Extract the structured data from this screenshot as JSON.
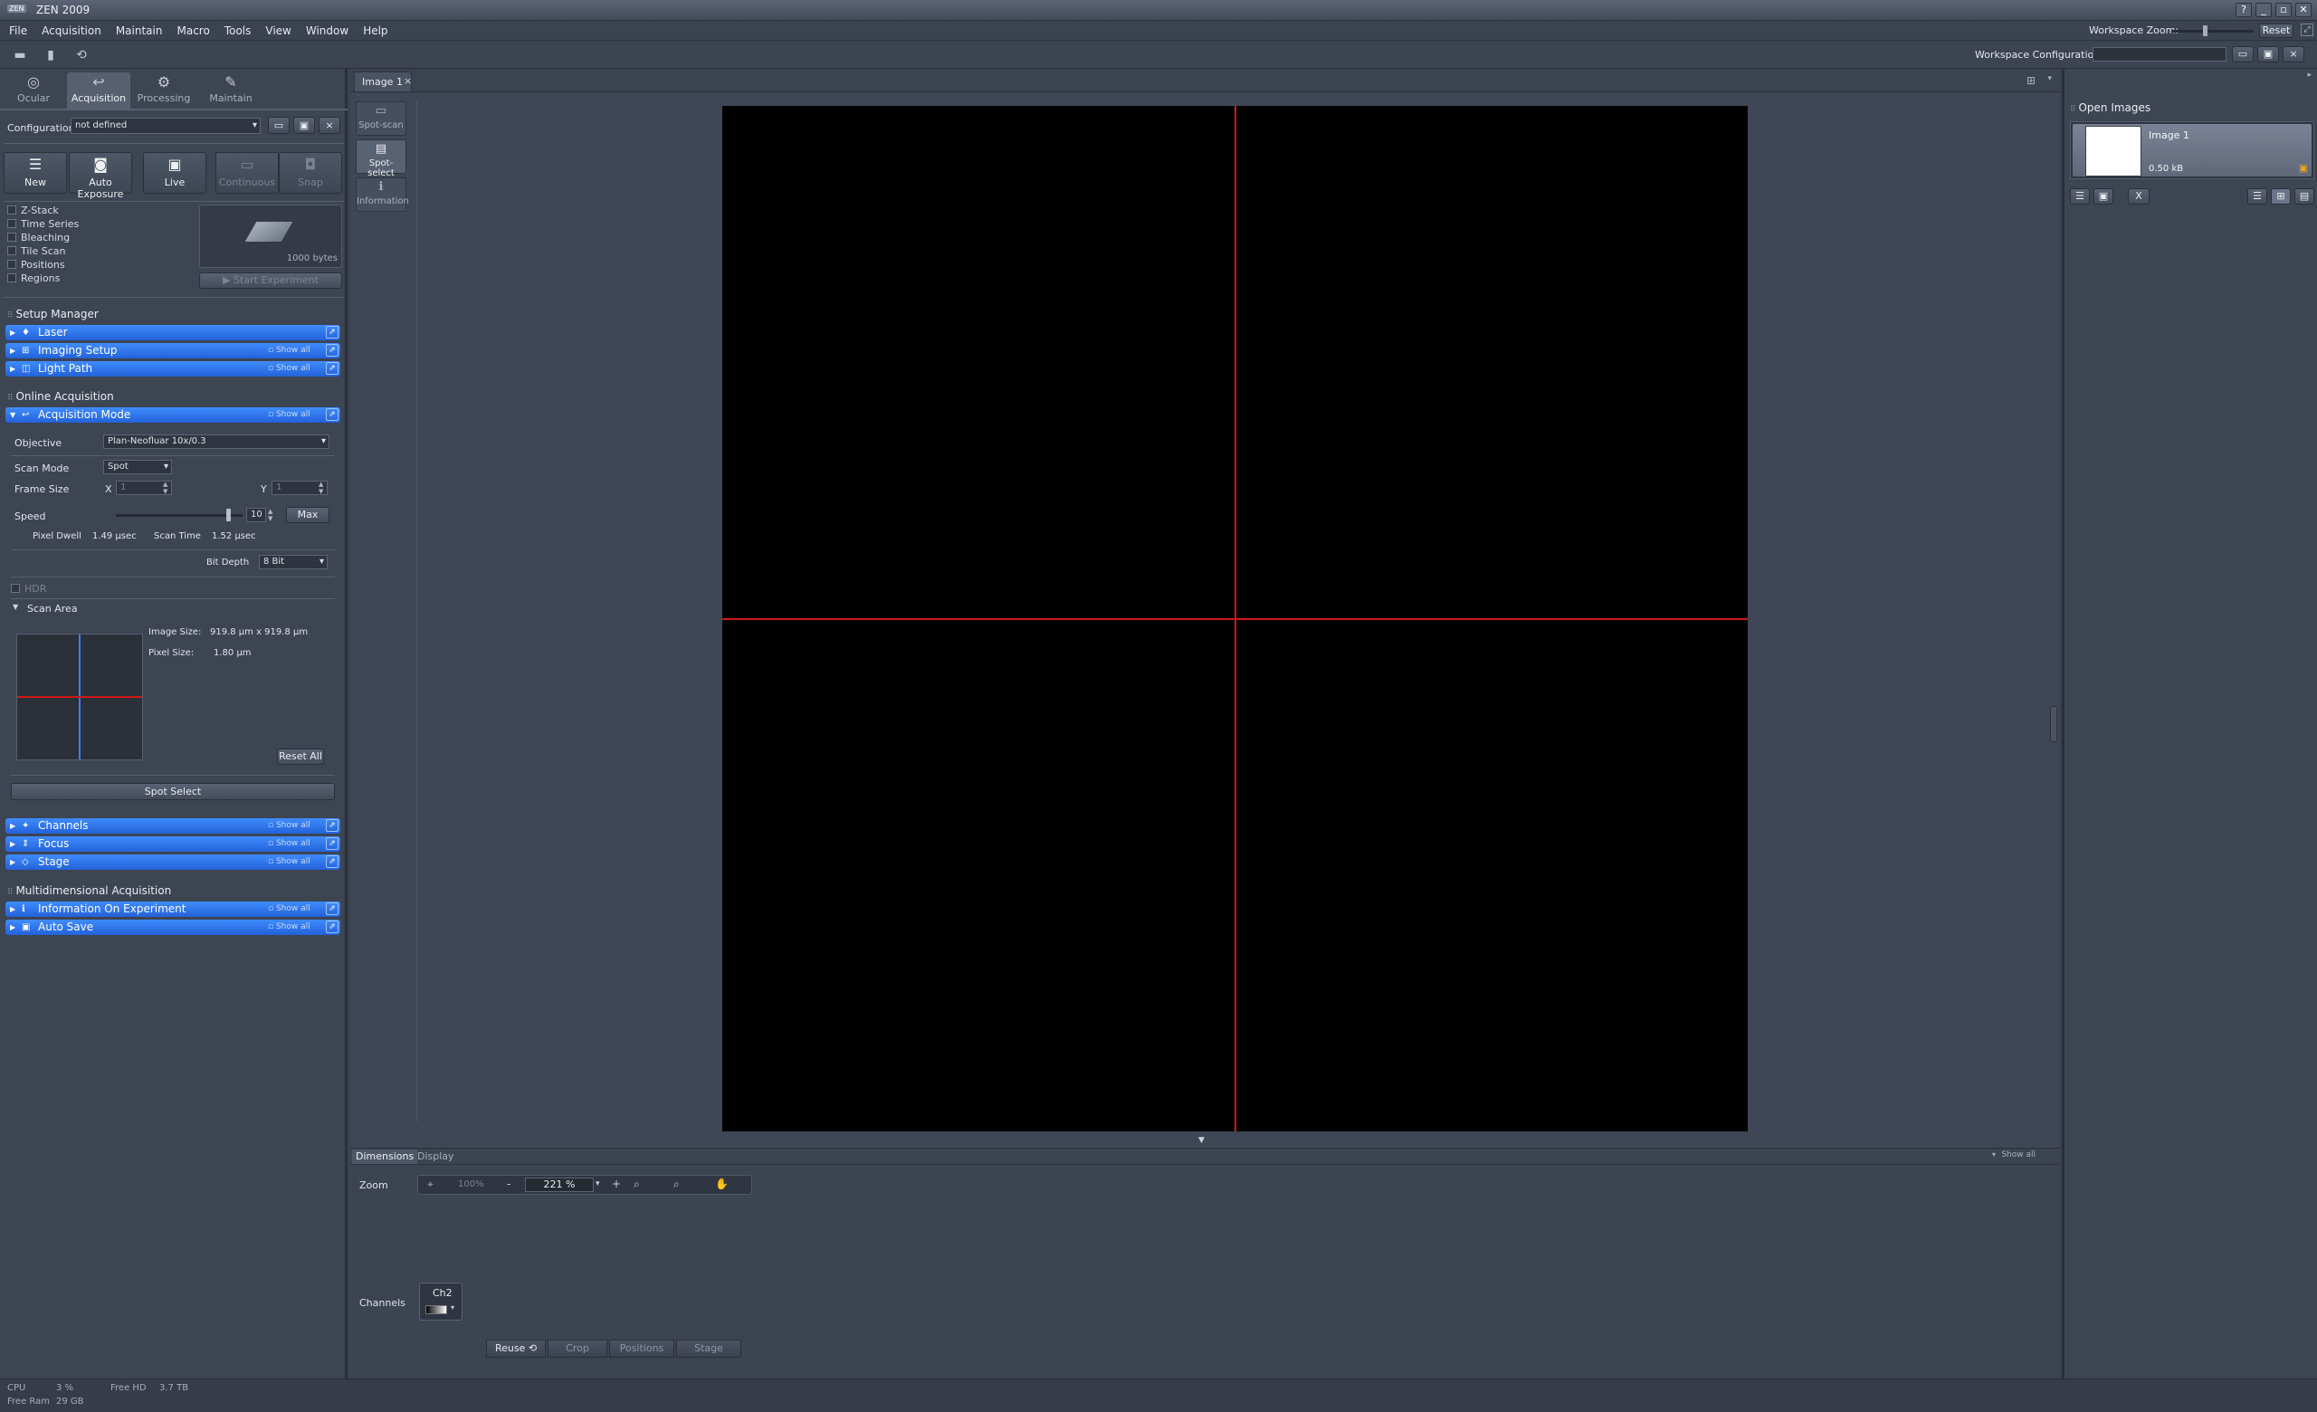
{
  "app": {
    "title": "ZEN 2009",
    "logo_text": "ZEN"
  },
  "titlebar": {
    "help": "?",
    "minimize": "_",
    "restore": "▫",
    "close": "✕"
  },
  "menu": [
    "File",
    "Acquisition",
    "Maintain",
    "Macro",
    "Tools",
    "View",
    "Window",
    "Help"
  ],
  "workspace": {
    "zoom_label": "Workspace Zoom:",
    "reset_label": "Reset",
    "config_label": "Workspace Configuration",
    "config_value": ""
  },
  "mode_tabs": [
    "Ocular",
    "Acquisition",
    "Processing",
    "Maintain"
  ],
  "configuration": {
    "label": "Configuration",
    "value": "not defined"
  },
  "acq_buttons": [
    {
      "label": "New",
      "icon": "list-icon",
      "enabled": true
    },
    {
      "label": "Auto Exposure",
      "icon": "camera-icon",
      "enabled": true
    },
    {
      "label": "Live",
      "icon": "video-icon",
      "enabled": true
    },
    {
      "label": "Continuous",
      "icon": "continuous-icon",
      "enabled": false
    },
    {
      "label": "Snap",
      "icon": "snap-icon",
      "enabled": false
    }
  ],
  "experiment_options": [
    "Z-Stack",
    "Time Series",
    "Bleaching",
    "Tile Scan",
    "Positions",
    "Regions"
  ],
  "experiment": {
    "size": "1000 bytes",
    "start_label": "Start Experiment"
  },
  "setup_manager": {
    "title": "Setup Manager",
    "tools": [
      {
        "label": "Laser",
        "show_all": ""
      },
      {
        "label": "Imaging Setup",
        "show_all": "Show all"
      },
      {
        "label": "Light Path",
        "show_all": "Show all"
      }
    ]
  },
  "online_acquisition": {
    "title": "Online Acquisition",
    "acq_mode": {
      "label": "Acquisition Mode",
      "show_all": "Show all"
    },
    "objective": {
      "label": "Objective",
      "value": "Plan-Neofluar 10x/0.3"
    },
    "scan_mode": {
      "label": "Scan Mode",
      "value": "Spot"
    },
    "frame_size": {
      "label": "Frame Size",
      "x_label": "X",
      "x_value": "1",
      "y_label": "Y",
      "y_value": "1"
    },
    "speed": {
      "label": "Speed",
      "value": "10",
      "max_label": "Max",
      "level": 0.9
    },
    "pixel_dwell": {
      "label": "Pixel Dwell",
      "value": "1.49 µsec"
    },
    "scan_time": {
      "label": "Scan Time",
      "value": "1.52 µsec"
    },
    "bit_depth": {
      "label": "Bit Depth",
      "value": "8 Bit"
    },
    "hdr_label": "HDR",
    "scan_area": {
      "label": "Scan Area",
      "image_size_label": "Image Size:",
      "image_size_value": "919.8  µm x 919.8  µm",
      "pixel_size_label": "Pixel Size:",
      "pixel_size_value": "1.80 µm",
      "reset_label": "Reset All"
    },
    "spot_select_label": "Spot Select",
    "tools": [
      {
        "label": "Channels",
        "show_all": "Show all"
      },
      {
        "label": "Focus",
        "show_all": "Show all"
      },
      {
        "label": "Stage",
        "show_all": "Show all"
      }
    ]
  },
  "multidimensional": {
    "title": "Multidimensional Acquisition",
    "tools": [
      {
        "label": "Information On Experiment",
        "show_all": "Show all"
      },
      {
        "label": "Auto Save",
        "show_all": "Show all"
      }
    ]
  },
  "document_tab": {
    "label": "Image 1",
    "close": "×"
  },
  "view_buttons": [
    "Spot-scan",
    "Spot-select",
    "Information"
  ],
  "bottom": {
    "tabs": [
      "Dimensions",
      "Display"
    ],
    "show_all": "Show all",
    "zoom": {
      "label": "Zoom",
      "hundred": "100%",
      "minus": "-",
      "value": "221 %",
      "plus": "+"
    },
    "channels": {
      "label": "Channels",
      "channel": "Ch2"
    },
    "actions": [
      "Reuse",
      "Crop",
      "Positions",
      "Stage"
    ]
  },
  "open_images": {
    "title": "Open Images",
    "item": {
      "name": "Image 1",
      "size": "0.50 kB"
    },
    "close_label": "X"
  },
  "status": {
    "cpu_label": "CPU",
    "cpu_value": "3 %",
    "hd_label": "Free HD",
    "hd_value": "3.7 TB",
    "ram_label": "Free Ram",
    "ram_value": "29 GB"
  },
  "colors": {
    "accent": "#2f74f0",
    "crosshair": "#d01818",
    "blue_line": "#3d7fe6"
  }
}
